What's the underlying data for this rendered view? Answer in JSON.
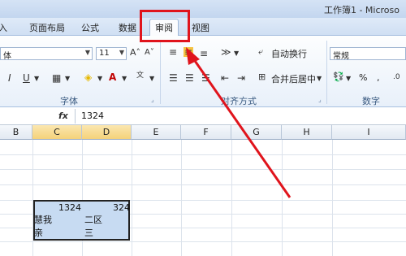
{
  "window": {
    "title": "工作簿1 - Microso"
  },
  "tabs": [
    {
      "label": "插入",
      "visible": "插入"
    },
    {
      "label": "页面布局"
    },
    {
      "label": "公式"
    },
    {
      "label": "数据"
    },
    {
      "label": "审阅"
    },
    {
      "label": "视图"
    }
  ],
  "ribbon": {
    "font_name": "体",
    "font_size": "11",
    "wrap_text": "自动换行",
    "merge_center": "合并后居中",
    "number_format": "常规",
    "percent": "%",
    "comma": ",",
    "groups": {
      "font": "字体",
      "alignment": "对齐方式",
      "number": "数字"
    }
  },
  "formula_bar": {
    "fx": "fx",
    "value": "1324"
  },
  "columns": [
    "B",
    "C",
    "D",
    "E",
    "F",
    "G",
    "H",
    "I"
  ],
  "cells": [
    {
      "value": "1324"
    },
    {
      "value": "324"
    },
    {
      "value": "慧我"
    },
    {
      "value": "二区"
    },
    {
      "value": "亲"
    },
    {
      "value": "三"
    }
  ],
  "colors": {
    "highlight": "#e0141c",
    "selection": "#c7dbf2",
    "active_column": "#f5d27a"
  }
}
